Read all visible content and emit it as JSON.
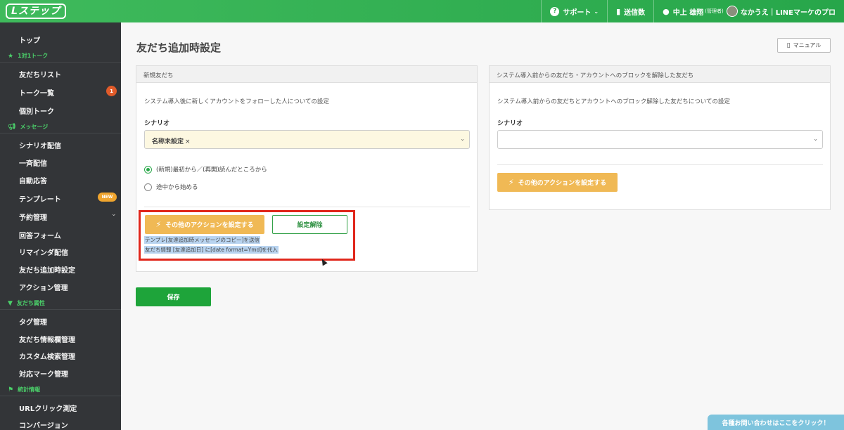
{
  "app": {
    "logo": "Lステップ"
  },
  "topnav": {
    "support": "サポート",
    "send_count": "送信数",
    "user_name": "中上 雄翔",
    "user_role": "(管理者)",
    "account": "なかうえ｜LINEマーケのプロ"
  },
  "sidebar": {
    "top": "トップ",
    "sec_talk": "1対1トーク",
    "friend_list": "友だちリスト",
    "talk_list": "トーク一覧",
    "talk_badge": "1",
    "individual_talk": "個別トーク",
    "sec_message": "メッセージ",
    "scenario": "シナリオ配信",
    "broadcast": "一斉配信",
    "auto_reply": "自動応答",
    "template": "テンプレート",
    "template_badge": "NEW",
    "reservation": "予約管理",
    "answer_form": "回答フォーム",
    "reminder": "リマインダ配信",
    "friend_add_settings": "友だち追加時設定",
    "action_mgmt": "アクション管理",
    "sec_friend_attr": "友だち属性",
    "tag_mgmt": "タグ管理",
    "friend_info_mgmt": "友だち情報欄管理",
    "custom_search": "カスタム検索管理",
    "mark_mgmt": "対応マーク管理",
    "sec_stats": "統計情報",
    "url_click": "URLクリック測定",
    "conversion": "コンバージョン"
  },
  "main": {
    "title": "友だち追加時設定",
    "manual": "マニュアル",
    "save": "保存"
  },
  "left_panel": {
    "header": "新規友だち",
    "desc": "システム導入後に新しくアカウントをフォローした人についての設定",
    "scenario_label": "シナリオ",
    "scenario_value": "名称未設定",
    "remove_mark": "×",
    "radio1": "(新規)最初から／(再開)読んだところから",
    "radio2": "途中から始める",
    "radio_selected": 1,
    "action_btn": "その他のアクションを設定する",
    "unset_btn": "設定解除",
    "action_line1": "テンプレ[友達追加時メッセージのコピー]を送信",
    "action_line2": "友だち情報 [友達追加日] に[date format=Ymd]を代入"
  },
  "right_panel": {
    "header": "システム導入前からの友だち・アカウントへのブロックを解除した友だち",
    "desc": "システム導入前からの友だちとアカウントへのブロック解除した友だちについての設定",
    "scenario_label": "シナリオ",
    "scenario_value": "",
    "action_btn": "その他のアクションを設定する"
  },
  "contact": "各種お問い合わせはここをクリック！",
  "colors": {
    "brand_green": "#2aa84a",
    "sidebar": "#333538",
    "orange": "#f0b955",
    "highlight": "#e0261b"
  }
}
